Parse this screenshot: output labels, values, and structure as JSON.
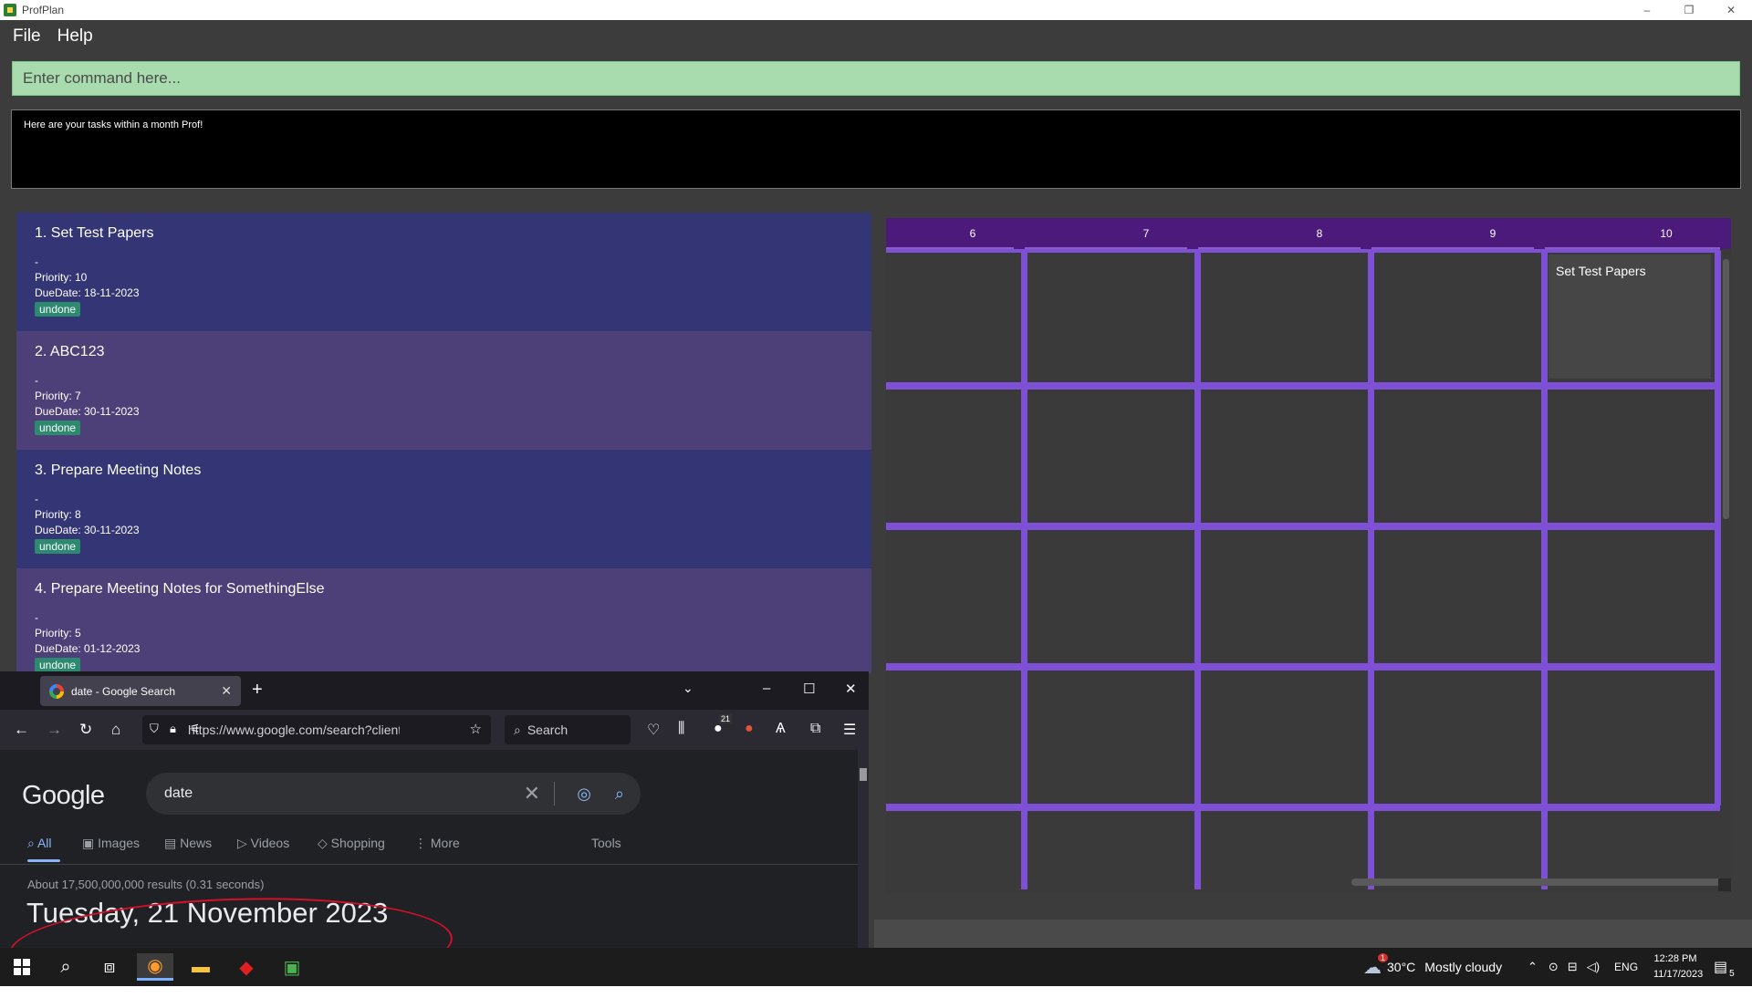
{
  "window": {
    "title": "ProfPlan",
    "controls": [
      "–",
      "❐",
      "✕"
    ]
  },
  "menu": {
    "file": "File",
    "help": "Help"
  },
  "command": {
    "placeholder": "Enter command here..."
  },
  "result": {
    "message": "Here are your tasks within a month Prof!"
  },
  "tasks": [
    {
      "title": "1.  Set Test Papers",
      "description": "-",
      "priority": "Priority: 10",
      "due": "DueDate: 18-11-2023",
      "status": "undone"
    },
    {
      "title": "2.  ABC123",
      "description": "-",
      "priority": "Priority: 7",
      "due": "DueDate: 30-11-2023",
      "status": "undone"
    },
    {
      "title": "3.  Prepare Meeting Notes",
      "description": "-",
      "priority": "Priority: 8",
      "due": "DueDate: 30-11-2023",
      "status": "undone"
    },
    {
      "title": "4.  Prepare Meeting Notes for SomethingElse",
      "description": "-",
      "priority": "Priority: 5",
      "due": "DueDate: 01-12-2023",
      "status": "undone"
    }
  ],
  "calendar": {
    "days": [
      "6",
      "7",
      "8",
      "9",
      "10"
    ],
    "event": "Set Test Papers"
  },
  "browser": {
    "tab_title": "date - Google Search",
    "url": "https://www.google.com/search?client=",
    "search_placeholder": "Search",
    "badge": "21",
    "google": {
      "logo": "Google",
      "query": "date",
      "tabs": [
        "All",
        "Images",
        "News",
        "Videos",
        "Shopping",
        "More",
        "Tools"
      ],
      "results_stats": "About 17,500,000,000 results (0.31 seconds)",
      "date_answer": "Tuesday, 21 November 2023"
    }
  },
  "taskbar": {
    "weather_temp": "30°C",
    "weather_text": "Mostly cloudy",
    "language": "ENG",
    "time": "12:28 PM",
    "date": "11/17/2023",
    "notification_count": "5",
    "weather_alert": "1"
  }
}
